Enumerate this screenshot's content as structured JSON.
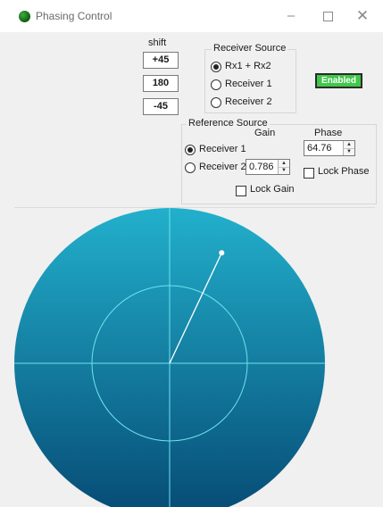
{
  "window": {
    "title": "Phasing Control",
    "min_glyph": "–",
    "close_glyph": "✕"
  },
  "shift": {
    "label": "shift",
    "values": [
      "+45",
      "180",
      "-45"
    ]
  },
  "receiver_source": {
    "title": "Receiver Source",
    "options": [
      "Rx1 + Rx2",
      "Receiver 1",
      "Receiver 2"
    ],
    "selected": 0
  },
  "enabled_button": {
    "label": "Enabled",
    "color": "#3fc84a"
  },
  "reference_source": {
    "title": "Reference Source",
    "options": [
      "Receiver 1",
      "Receiver 2"
    ],
    "selected": 0,
    "gain_label": "Gain",
    "gain_value": "0.786",
    "lock_gain_label": "Lock Gain",
    "phase_label": "Phase",
    "phase_value": "64.76",
    "lock_phase_label": "Lock Phase"
  },
  "scope": {
    "colors": {
      "top": "#22b0cc",
      "bottom": "#064a74",
      "lines": "#6fe2ef",
      "vector": "#ffffff"
    },
    "vector_angle_deg": 64.76,
    "vector_magnitude_fraction": 0.786,
    "inner_circle_fraction": 0.5
  }
}
